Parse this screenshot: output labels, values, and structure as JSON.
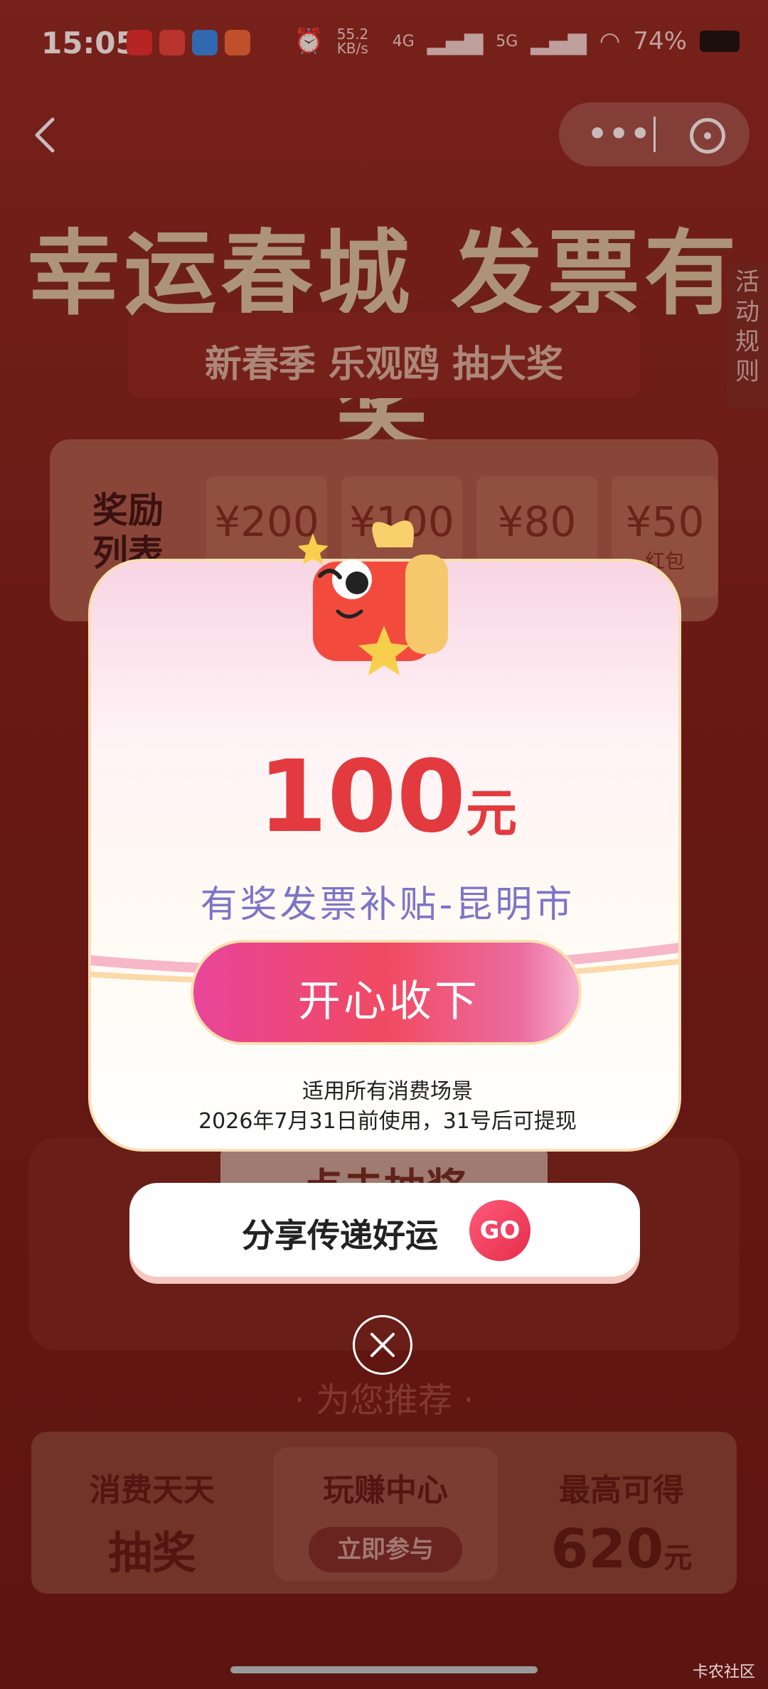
{
  "status_bar": {
    "time": "15:05",
    "net_speed": "55.2 KB/s",
    "net_4g": "4G",
    "net_5g": "5G",
    "battery": "74%"
  },
  "nav": {
    "more_icon": "more-dots-icon",
    "close_icon": "close-circle-icon"
  },
  "hero": {
    "title": "幸运春城 发票有奖",
    "subtitle": "新春季 乐观鸥 抽大奖",
    "rules_tab": "活动规则"
  },
  "rewards": {
    "label": "奖励列表",
    "items": [
      {
        "amount": "¥200",
        "sub": ""
      },
      {
        "amount": "¥100",
        "sub": ""
      },
      {
        "amount": "¥80",
        "sub": ""
      },
      {
        "amount": "¥50",
        "sub": "红包"
      }
    ]
  },
  "draw": {
    "label": "点击抽奖"
  },
  "recommend": {
    "label": "· 为您推荐 ·"
  },
  "promo": {
    "left_title": "消费天天",
    "left_big": "抽奖",
    "mid_title": "玩赚中心",
    "mid_button": "立即参与",
    "right_title": "最高可得",
    "right_amount": "620",
    "right_unit": "元"
  },
  "modal": {
    "amount": "100",
    "unit": "元",
    "subsidy": "有奖发票补贴-昆明市",
    "accept_button": "开心收下",
    "note_line1": "适用所有消费场景",
    "note_line2": "2026年7月31日前使用，31号后可提现"
  },
  "share": {
    "label": "分享传递好运",
    "go": "GO"
  },
  "watermark": "卡农社区",
  "colors": {
    "amount_red": "#e23a3e",
    "subsidy_purple": "#7d74c8",
    "button_pink": "#f04a62"
  }
}
